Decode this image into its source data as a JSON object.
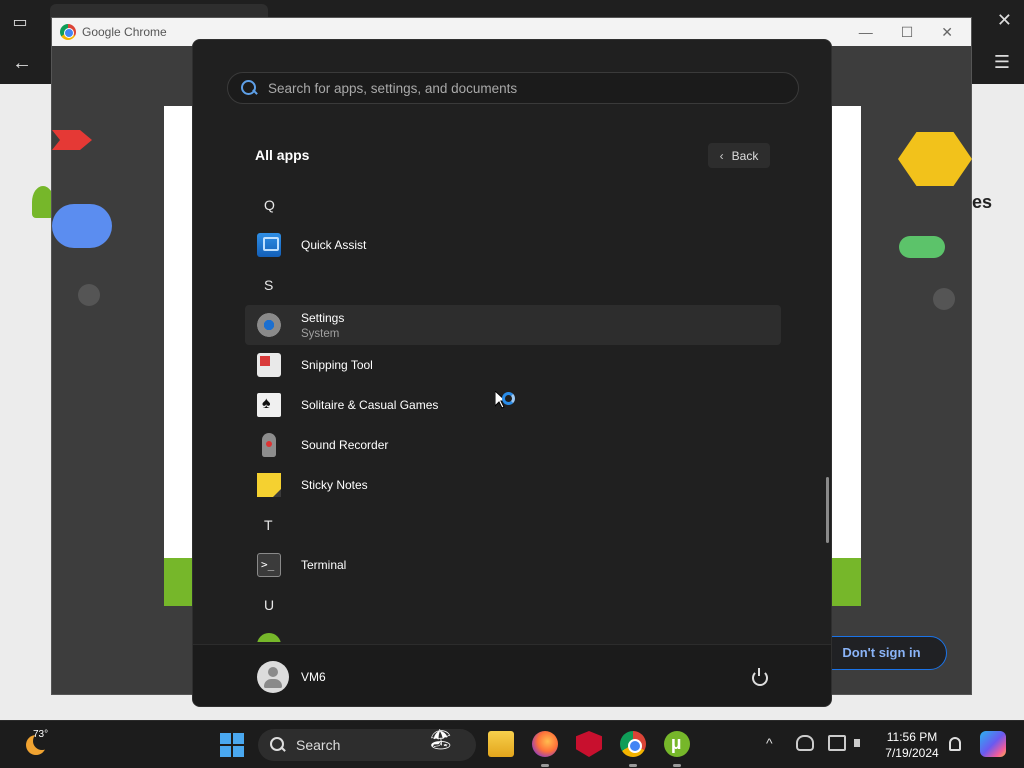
{
  "browser": {
    "window_title": "Google Chrome",
    "bg_text_right": "es",
    "dont_sign_in": "Don't sign in"
  },
  "search": {
    "placeholder": "Search for apps, settings, and documents"
  },
  "all_apps": {
    "title": "All apps",
    "back_label": "Back",
    "sections": [
      {
        "letter": "Q",
        "apps": [
          {
            "name": "Quick Assist",
            "icon": "quick-assist-icon"
          }
        ]
      },
      {
        "letter": "S",
        "apps": [
          {
            "name": "Settings",
            "subtitle": "System",
            "icon": "settings-icon",
            "selected": true
          },
          {
            "name": "Snipping Tool",
            "icon": "snipping-tool-icon"
          },
          {
            "name": "Solitaire & Casual Games",
            "icon": "solitaire-icon"
          },
          {
            "name": "Sound Recorder",
            "icon": "sound-recorder-icon"
          },
          {
            "name": "Sticky Notes",
            "icon": "sticky-notes-icon"
          }
        ]
      },
      {
        "letter": "T",
        "apps": [
          {
            "name": "Terminal",
            "icon": "terminal-icon"
          }
        ]
      },
      {
        "letter": "U",
        "apps": [
          {
            "name": "",
            "icon": "utorrent-icon"
          }
        ]
      }
    ]
  },
  "footer": {
    "user_name": "VM6",
    "power_icon": "power-icon"
  },
  "taskbar": {
    "temperature": "73°",
    "search_label": "Search",
    "time": "11:56 PM",
    "date": "7/19/2024",
    "pinned": [
      "file-explorer-icon",
      "firefox-icon",
      "mcafee-icon",
      "chrome-icon",
      "utorrent-icon"
    ],
    "tray": [
      "chevron-up-icon",
      "onedrive-icon",
      "network-icon",
      "volume-icon",
      "bell-icon",
      "copilot-icon"
    ]
  },
  "colors": {
    "menu_bg": "#202020",
    "accent": "#4aa8f0",
    "selected_row": "#2d2d2d"
  }
}
